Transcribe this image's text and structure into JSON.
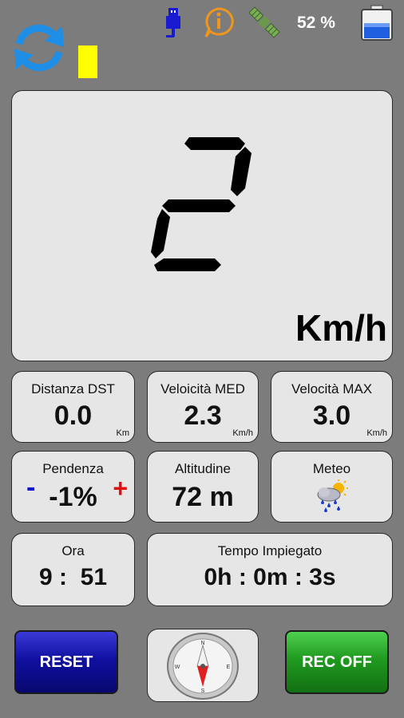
{
  "status_bar": {
    "battery_percent": "52 %",
    "battery_level": 0.52,
    "icons": [
      "usb-icon",
      "info-icon",
      "satellite-icon",
      "battery-icon"
    ]
  },
  "top": {
    "refresh_icon": "refresh-icon",
    "indicator_color": "#ffff00"
  },
  "speed": {
    "value": "2",
    "unit": "Km/h"
  },
  "tiles": {
    "distance": {
      "title": "Distanza DST",
      "value": "0.0",
      "unit": "Km"
    },
    "avg_speed": {
      "title": "Veloicità MED",
      "value": "2.3",
      "unit": "Km/h"
    },
    "max_speed": {
      "title": "Velocità MAX",
      "value": "3.0",
      "unit": "Km/h"
    },
    "slope": {
      "title": "Pendenza",
      "minus": "-",
      "value": "-1%",
      "plus": "+"
    },
    "altitude": {
      "title": "Altitudine",
      "value": "72 m"
    },
    "weather": {
      "title": "Meteo",
      "icon": "rain-sun-icon"
    },
    "time": {
      "title": "Ora",
      "value": "9 :  51"
    },
    "elapsed": {
      "title": "Tempo Impiegato",
      "value": "0h : 0m : 3s"
    }
  },
  "buttons": {
    "reset": "RESET",
    "compass_icon": "compass-icon",
    "rec": "REC OFF"
  },
  "colors": {
    "background": "#7c7c7c",
    "panel": "#e6e6e6",
    "accent_blue": "#1e8ee6",
    "reset_blue": "#1010a0",
    "rec_green": "#1f9a1f",
    "minus_blue": "#1414d0",
    "plus_red": "#e01010"
  }
}
